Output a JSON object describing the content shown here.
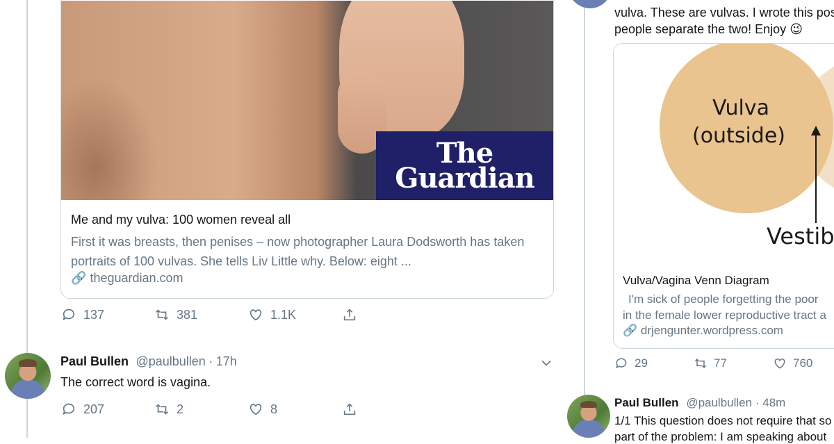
{
  "left_tweet": {
    "card": {
      "brand_line1": "The",
      "brand_line2": "Guardian",
      "title": "Me and my vulva: 100 women reveal all",
      "description": "First it was breasts, then penises – now photographer Laura Dodsworth has taken portraits of 100 vulvas. She tells Liv Little why. Below: eight ...",
      "link": "theguardian.com"
    },
    "actions": {
      "replies": "137",
      "retweets": "381",
      "likes": "1.1K"
    }
  },
  "reply": {
    "name": "Paul Bullen",
    "handle": "@paulbullen",
    "separator": "·",
    "time": "17h",
    "text": "The correct word is vagina.",
    "actions": {
      "replies": "207",
      "retweets": "2",
      "likes": "8"
    }
  },
  "right_tweet": {
    "text_line1": "vulva. These are vulvas. I wrote this post w",
    "text_line2": "people separate the two! Enjoy",
    "emoji": "😉",
    "card": {
      "venn_label1": "Vulva",
      "venn_label2": "(outside)",
      "venn_label3": "Vestib",
      "title": "Vulva/Vagina Venn Diagram",
      "description_line1": "I'm sick of people forgetting the poor",
      "description_line2": "in the female lower reproductive tract a",
      "link": "drjengunter.wordpress.com"
    },
    "actions": {
      "replies": "29",
      "retweets": "77",
      "likes": "760"
    }
  },
  "right_reply": {
    "name": "Paul Bullen",
    "handle": "@paulbullen",
    "separator": "·",
    "time": "48m",
    "text_line1": "1/1 This question does not require that so",
    "text_line2": "part of the problem: I am speaking about"
  },
  "colors": {
    "text": "#14171a",
    "muted": "#657786",
    "border": "#ccd6dd",
    "guardian_blue": "#1f2067"
  }
}
